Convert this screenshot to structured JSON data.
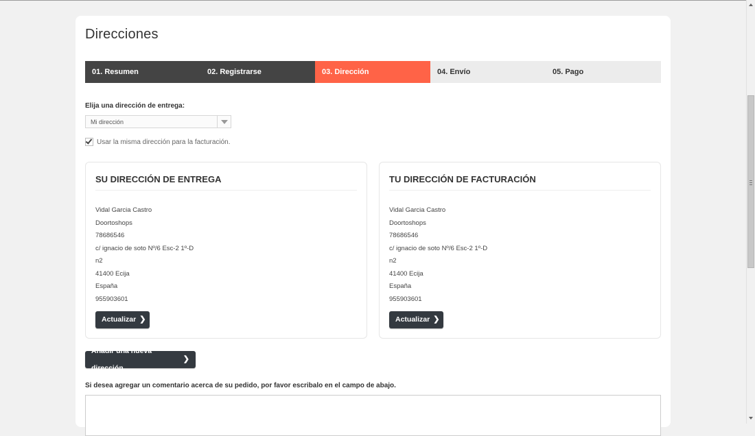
{
  "page": {
    "title": "Direcciones"
  },
  "steps": [
    {
      "label": "01. Resumen",
      "state": "done"
    },
    {
      "label": "02. Registrarse",
      "state": "done"
    },
    {
      "label": "03. Dirección",
      "state": "current"
    },
    {
      "label": "04. Envío",
      "state": "todo"
    },
    {
      "label": "05. Pago",
      "state": "todo"
    }
  ],
  "address_select": {
    "label": "Elija una dirección de entrega:",
    "value": "Mi dirección"
  },
  "same_billing": {
    "label": "Usar la misma dirección para la facturación.",
    "checked": true
  },
  "delivery": {
    "title": "SU DIRECCIÓN DE ENTREGA",
    "lines": [
      "Vidal Garcia Castro",
      "Doortoshops",
      "78686546",
      "c/ ignacio de soto Nº/6 Esc-2 1º-D",
      "n2",
      "41400 Ecija",
      "España",
      "955903601"
    ],
    "button": "Actualizar"
  },
  "billing": {
    "title": "TU DIRECCIÓN DE FACTURACIÓN",
    "lines": [
      "Vidal Garcia Castro",
      "Doortoshops",
      "78686546",
      "c/ ignacio de soto Nº/6 Esc-2 1º-D",
      "n2",
      "41400 Ecija",
      "España",
      "955903601"
    ],
    "button": "Actualizar"
  },
  "add_address": {
    "label": "Añadir una nueva dirección"
  },
  "comment": {
    "label": "Si desea agregar un comentario acerca de su pedido, por favor escribalo en el campo de abajo.",
    "value": ""
  },
  "colors": {
    "active_step": "#ff6347",
    "dark_step": "#444444",
    "inactive_step": "#ececec",
    "button_dark": "#343a40"
  },
  "icons": {
    "button_chevron": "chevron-right-icon",
    "select_arrow": "caret-down-icon",
    "checkbox": "check-icon"
  }
}
